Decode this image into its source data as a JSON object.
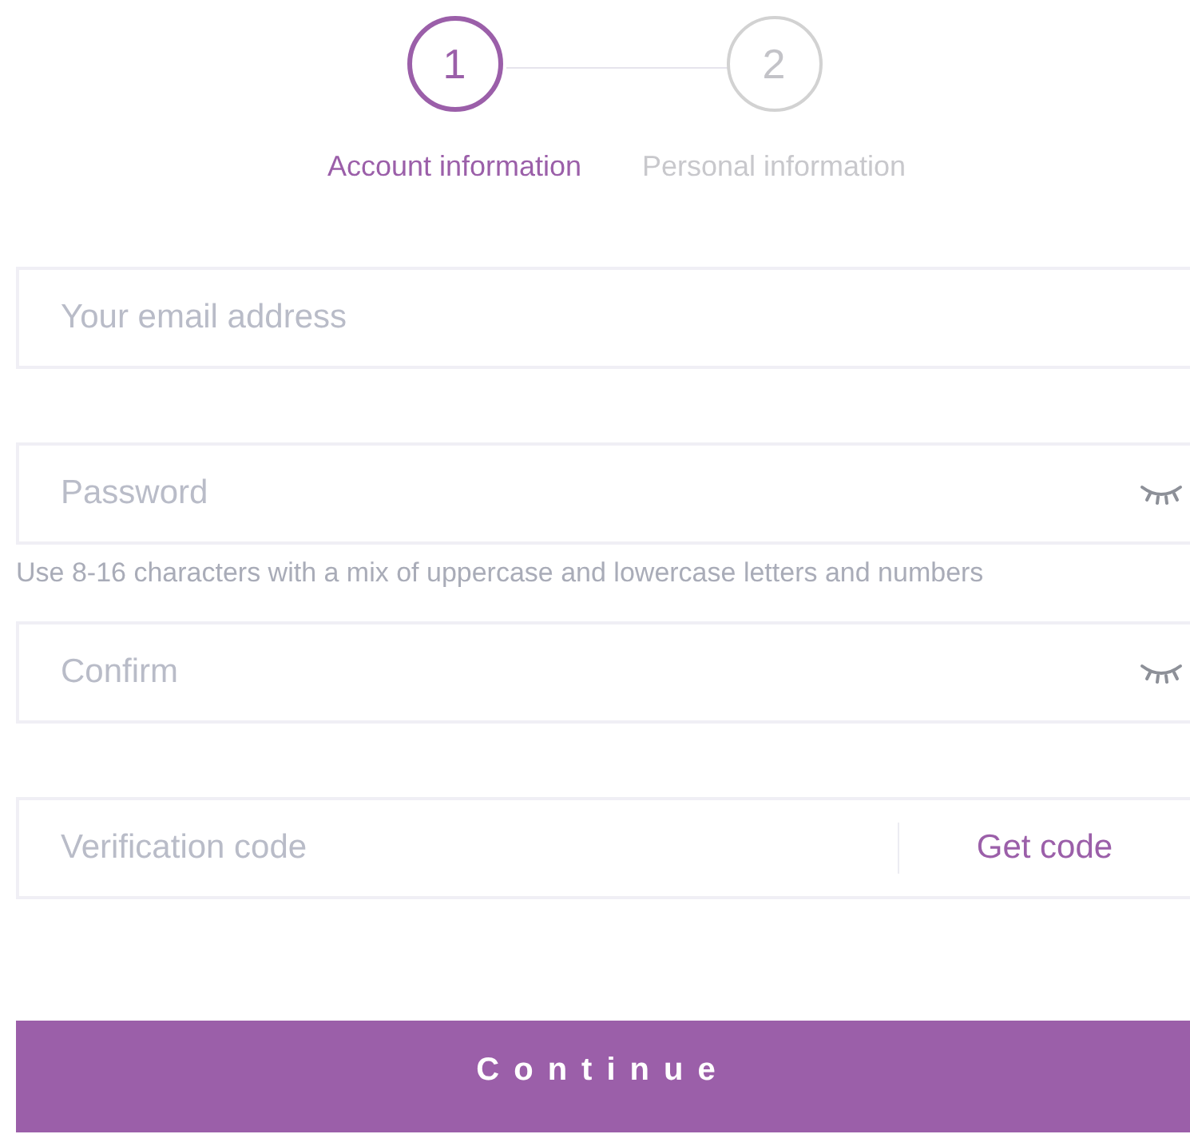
{
  "steps": [
    {
      "number": "1",
      "label": "Account information",
      "selected": true
    },
    {
      "number": "2",
      "label": "Personal information",
      "selected": false
    }
  ],
  "fields": [
    {
      "kind": "text",
      "placeholder": "Your email address"
    },
    {
      "kind": "password",
      "placeholder": "Password",
      "hint": "Use 8-16 characters with a mix of uppercase and lowercase letters and numbers"
    },
    {
      "kind": "password",
      "placeholder": "Confirm"
    },
    {
      "kind": "code",
      "placeholder": "Verification code",
      "action": "Get code"
    }
  ],
  "submit": "Continue"
}
